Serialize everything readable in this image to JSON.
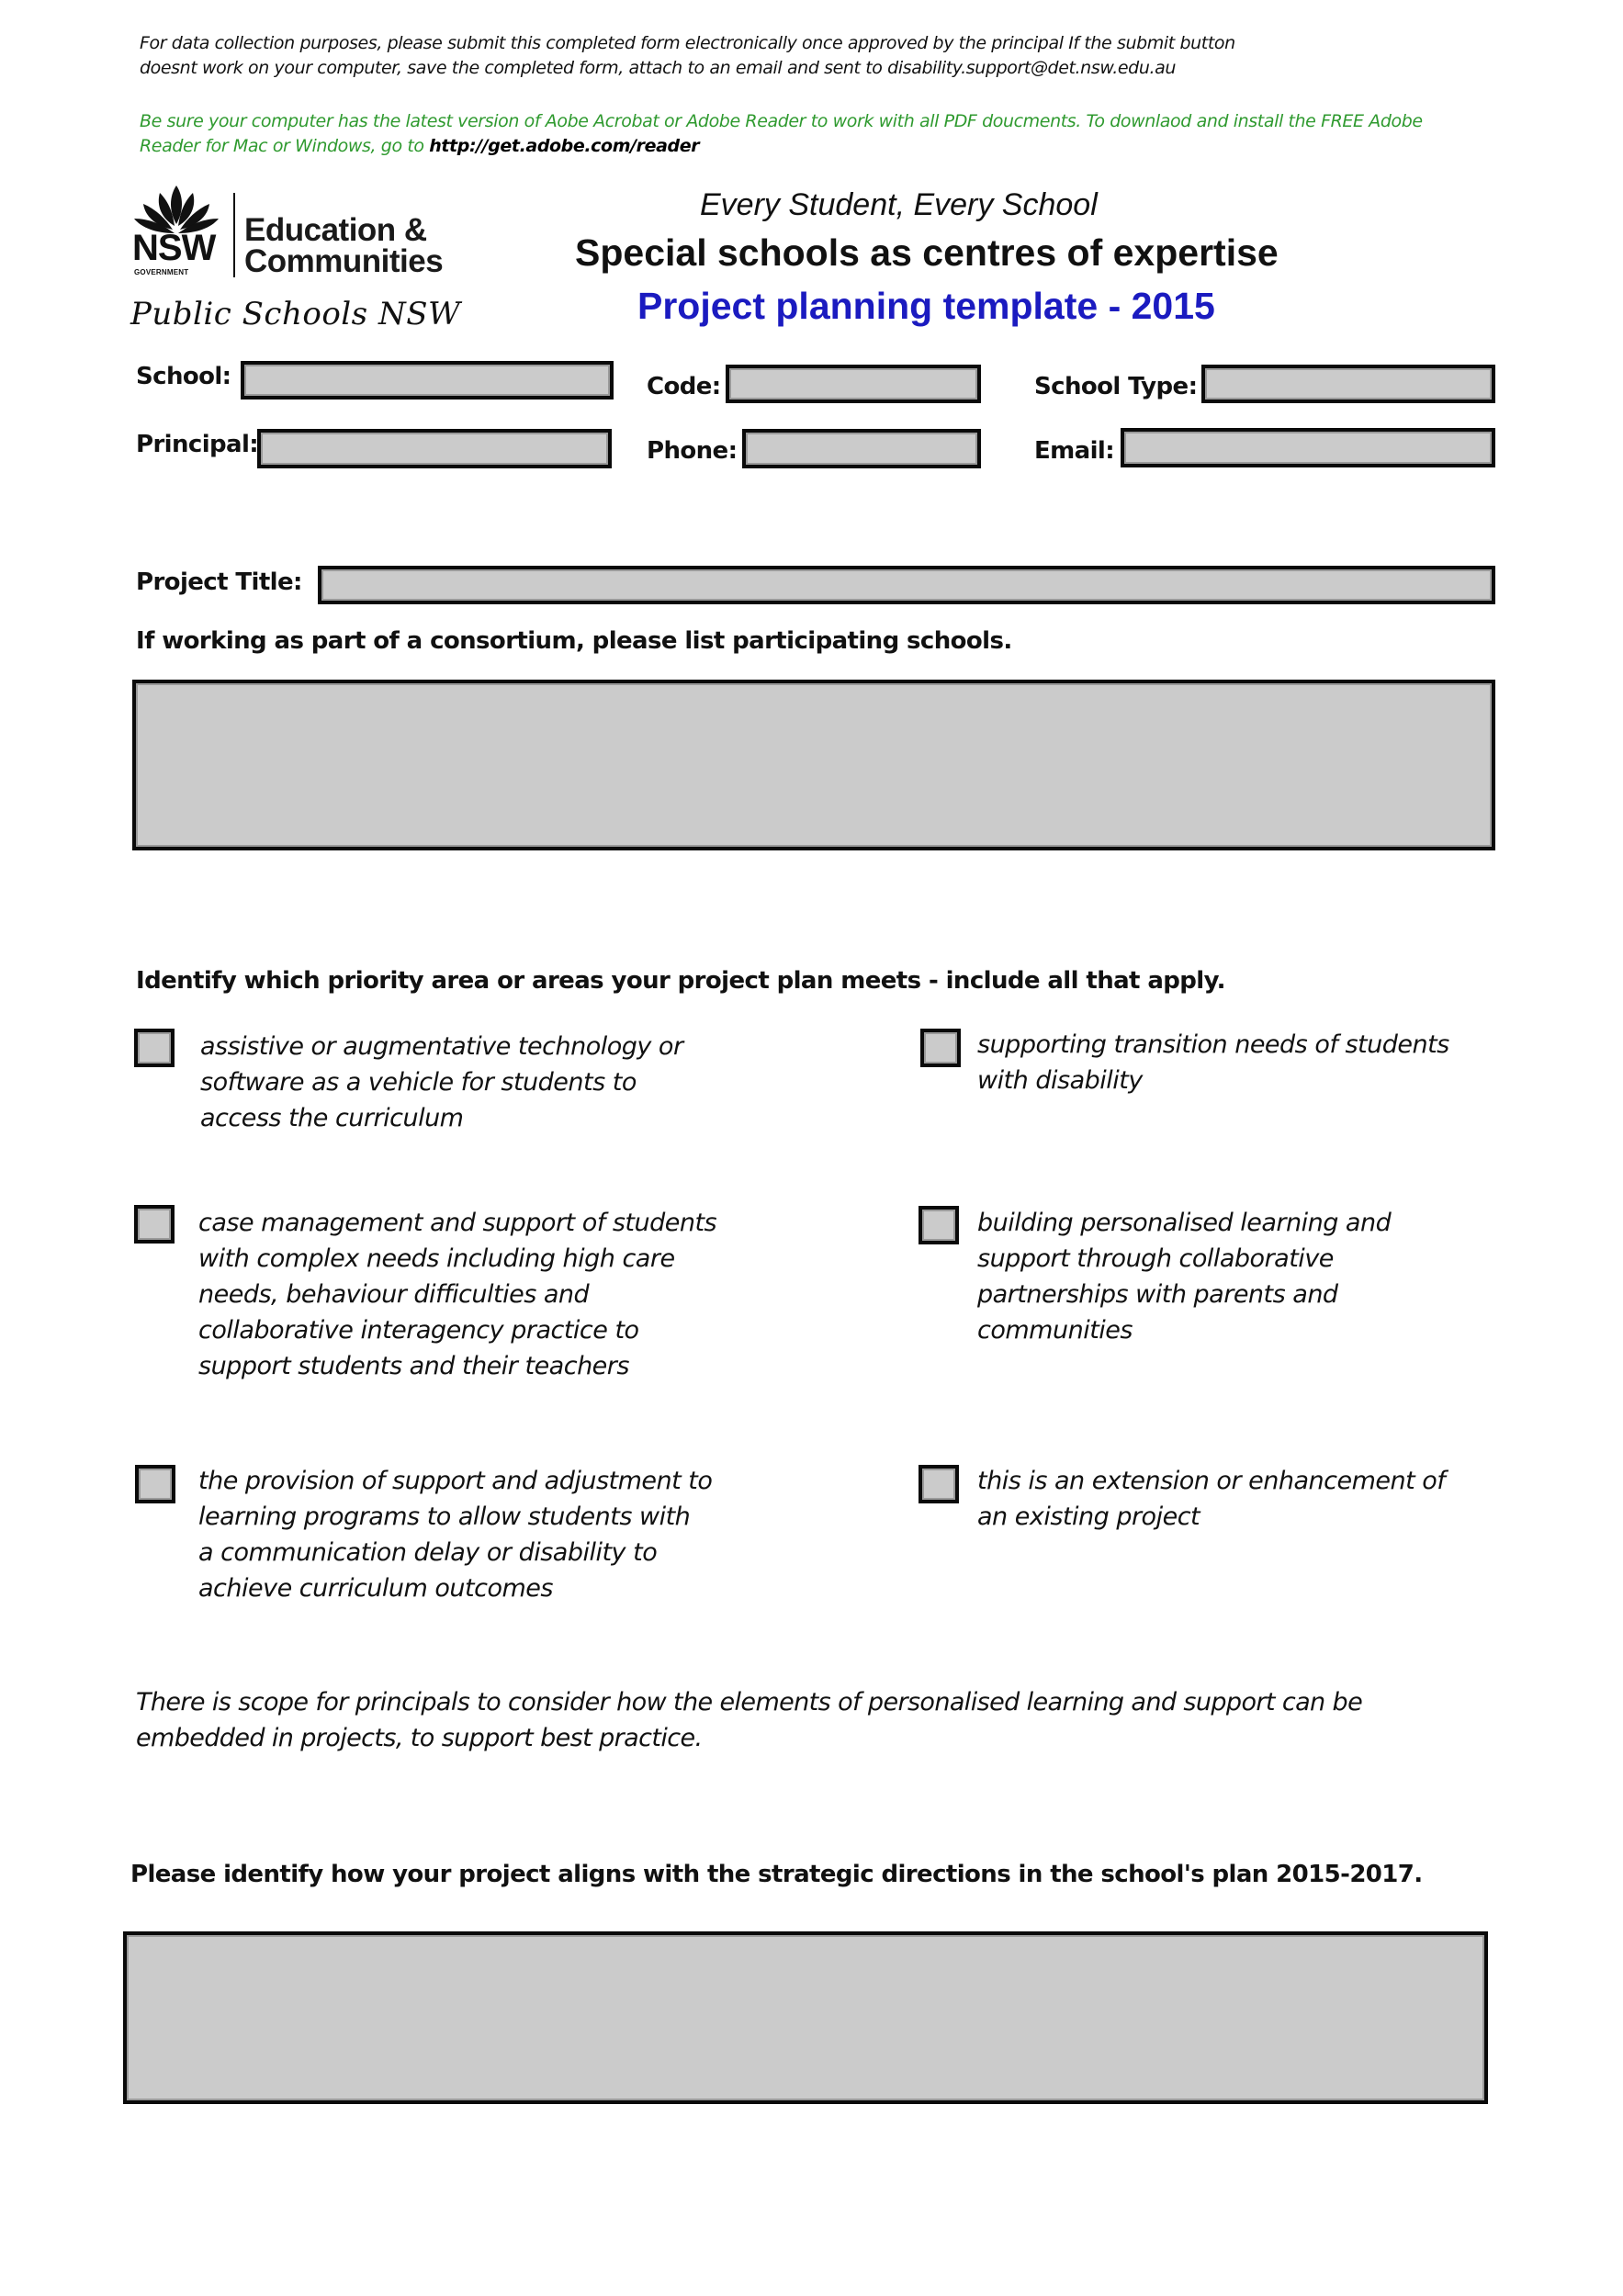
{
  "notice": {
    "line1": "For data collection purposes, please submit this completed form electronically once approved by the principal If the submit button",
    "line2": "doesnt work on your computer, save the completed form, attach to an email and sent to disability.support@det.nsw.edu.au",
    "green_line1": "Be sure your computer has the latest version of Aobe Acrobat or Adobe Reader to work with all PDF doucments. To downlaod and install the FREE Adobe",
    "green_line2_prefix": "Reader for Mac or Windows, go to ",
    "reader_link": "http://get.adobe.com/reader"
  },
  "logo": {
    "nsw": "NSW",
    "government": "GOVERNMENT",
    "dept_line1": "Education &",
    "dept_line2": "Communities",
    "tagline": "Public Schools NSW"
  },
  "header": {
    "subtitle": "Every Student, Every School",
    "title": "Special schools as centres of expertise",
    "form_title": "Project planning template - 2015"
  },
  "colors": {
    "title_blue": "#1b1bc0",
    "notice_green": "#2f9a2f",
    "field_fill": "#cbcbcb"
  },
  "fields": {
    "school": {
      "label": "School:",
      "value": ""
    },
    "code": {
      "label": "Code:",
      "value": ""
    },
    "school_type": {
      "label": "School Type:",
      "value": ""
    },
    "principal": {
      "label": "Principal:",
      "value": ""
    },
    "phone": {
      "label": "Phone:",
      "value": ""
    },
    "email": {
      "label": "Email:",
      "value": ""
    },
    "project_title": {
      "label": "Project Title:",
      "value": ""
    }
  },
  "consortium": {
    "label": "If working as part of a consortium, please list participating schools.",
    "value": ""
  },
  "priority": {
    "heading": "Identify which priority area or areas your project plan meets - include all that apply.",
    "options": [
      {
        "lines": [
          "assistive or augmentative technology or",
          "software as a vehicle for students to",
          "access the curriculum"
        ],
        "checked": false
      },
      {
        "lines": [
          "supporting transition needs of students",
          "with disability"
        ],
        "checked": false
      },
      {
        "lines": [
          "case management and support of students",
          "with complex needs including high care",
          "needs, behaviour difficulties and",
          "collaborative interagency practice to",
          "support students and their teachers"
        ],
        "checked": false
      },
      {
        "lines": [
          "building personalised learning and",
          "support through collaborative",
          "partnerships with parents and",
          "communities"
        ],
        "checked": false
      },
      {
        "lines": [
          "the provision of support and adjustment to",
          "learning programs to allow students with",
          "a communication delay or disability to",
          "achieve curriculum outcomes"
        ],
        "checked": false
      },
      {
        "lines": [
          "this is an extension or enhancement of",
          "an existing project"
        ],
        "checked": false
      }
    ]
  },
  "scope_note": {
    "line1": "There is scope for principals to consider how the elements of personalised learning and support can be",
    "line2": "embedded in projects, to support best practice."
  },
  "alignment": {
    "label": "Please identify how your project aligns with the strategic directions in the school's plan 2015-2017.",
    "value": ""
  }
}
